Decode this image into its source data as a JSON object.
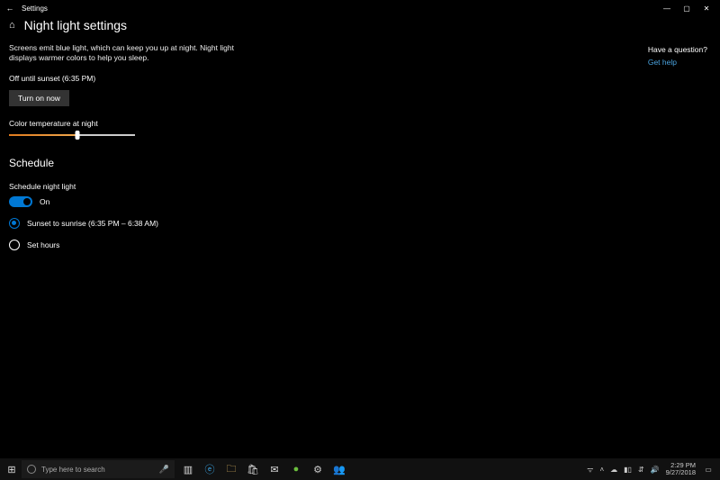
{
  "titlebar": {
    "title": "Settings"
  },
  "header": {
    "heading": "Night light settings"
  },
  "main": {
    "description": "Screens emit blue light, which can keep you up at night. Night light displays warmer colors to help you sleep.",
    "status": "Off until sunset (6:35 PM)",
    "turn_on_label": "Turn on now",
    "color_temp_label": "Color temperature at night"
  },
  "schedule": {
    "heading": "Schedule",
    "toggle_label": "Schedule night light",
    "toggle_value": "On",
    "radio_sunset": "Sunset to sunrise (6:35 PM – 6:38 AM)",
    "radio_sethours": "Set hours"
  },
  "side": {
    "question": "Have a question?",
    "help_link": "Get help"
  },
  "taskbar": {
    "search_placeholder": "Type here to search",
    "time": "2:29 PM",
    "date": "9/27/2018"
  }
}
